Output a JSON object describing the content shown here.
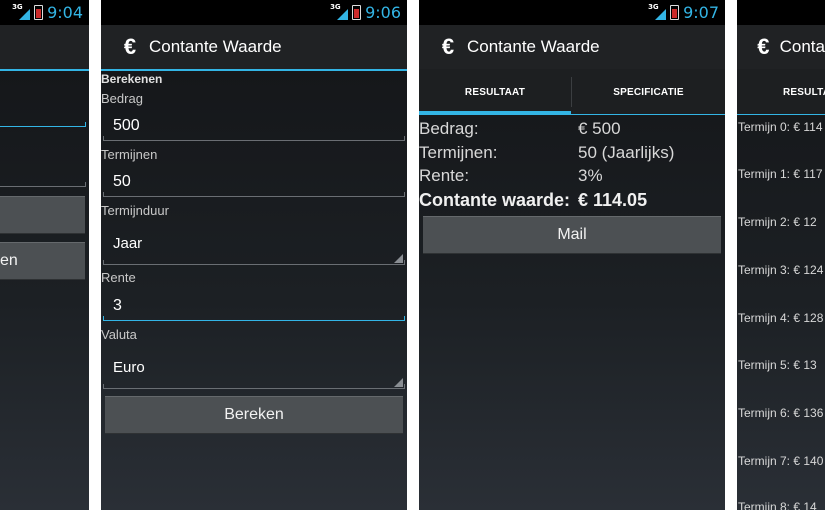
{
  "screens": [
    {
      "status_time": "9:04",
      "network": "3G",
      "fragment_button": "en"
    },
    {
      "status_time": "9:06",
      "network": "3G",
      "app_title": "Contante Waarde",
      "app_icon": "euro-icon",
      "section_header": "Berekenen",
      "bedrag_label": "Bedrag",
      "bedrag_value": "500",
      "termijnen_label": "Termijnen",
      "termijnen_value": "50",
      "termijnduur_label": "Termijnduur",
      "termijnduur_value": "Jaar",
      "rente_label": "Rente",
      "rente_value": "3",
      "valuta_label": "Valuta",
      "valuta_value": "Euro",
      "bereken_button": "Bereken"
    },
    {
      "status_time": "9:07",
      "network": "3G",
      "app_title": "Contante Waarde",
      "tab_resultaat": "RESULTAAT",
      "tab_specificatie": "SPECIFICATIE",
      "rows": [
        {
          "label": "Bedrag:",
          "value": "€ 500"
        },
        {
          "label": "Termijnen:",
          "value": "50 (Jaarlijks)"
        },
        {
          "label": "Rente:",
          "value": "3%"
        },
        {
          "label": "Contante waarde:",
          "value": "€ 114.05"
        }
      ],
      "mail_button": "Mail"
    },
    {
      "app_title": "Conta",
      "tab_fragment": "RESULTA",
      "terms": [
        "Termijn 0: € 114",
        "Termijn 1: € 117",
        "Termijn 2: € 12",
        "Termijn 3: € 124",
        "Termijn 4: € 128",
        "Termijn 5: € 13",
        "Termijn 6: € 136",
        "Termijn 7: € 140",
        "Termijn 8: € 14"
      ]
    }
  ],
  "colors": {
    "accent": "#33b5e5",
    "background": "#1a1c1e",
    "button": "#4c5053"
  }
}
